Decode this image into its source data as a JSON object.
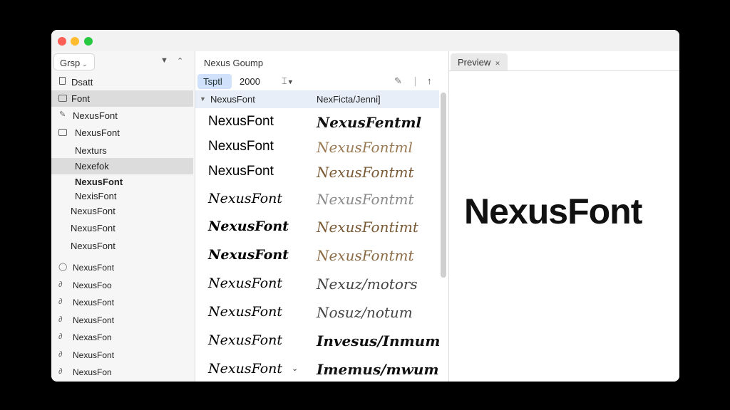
{
  "window": {
    "traffic_lights": [
      "close",
      "minimize",
      "zoom"
    ]
  },
  "sidebar": {
    "group_label": "Grsp",
    "items": [
      {
        "label": "Dsatt",
        "icon": "document-icon",
        "selected": false
      },
      {
        "label": "Font",
        "icon": "folder-icon",
        "selected": true
      },
      {
        "label": "NexusFont",
        "icon": "pencil-icon",
        "selected": false
      },
      {
        "label": "NexusFont",
        "icon": "folder-icon",
        "selected": false
      },
      {
        "label": "Nexturs",
        "icon": "",
        "selected": false
      },
      {
        "label": "Nexefok",
        "icon": "",
        "selected": true
      },
      {
        "label": "NexusFont",
        "icon": "",
        "selected": false,
        "bold": true
      },
      {
        "label": "NexisFont",
        "icon": "",
        "selected": false
      },
      {
        "label": "NexusFont",
        "icon": "",
        "selected": false
      },
      {
        "label": "NexusFont",
        "icon": "",
        "selected": false
      },
      {
        "label": "NexusFont",
        "icon": "",
        "selected": false
      },
      {
        "label": "NexusFont",
        "icon": "circle-icon",
        "selected": false
      },
      {
        "label": "NexusFoo",
        "icon": "link-icon",
        "selected": false
      },
      {
        "label": "NexusFont",
        "icon": "link-icon",
        "selected": false
      },
      {
        "label": "NexusFont",
        "icon": "link-icon",
        "selected": false
      },
      {
        "label": "NexasFon",
        "icon": "link-icon",
        "selected": false
      },
      {
        "label": "NexusFont",
        "icon": "link-icon",
        "selected": false
      },
      {
        "label": "NexusFon",
        "icon": "link-icon",
        "selected": false
      }
    ]
  },
  "middle": {
    "title": "Nexus Goump",
    "toolbar": {
      "search_value": "Tsptl",
      "size_value": "2000"
    },
    "list_header": {
      "col1": "NexusFont",
      "col2": "NexFicta/Jenni]"
    },
    "rows": [
      {
        "name": "NexusFont",
        "sample": "NexusFentml"
      },
      {
        "name": "NexusFont",
        "sample": "NexusFontml"
      },
      {
        "name": "NexusFont",
        "sample": "NexusFontmt"
      },
      {
        "name": "NexusFont",
        "sample": "NexusFontmt"
      },
      {
        "name": "NexusFont",
        "sample": "NexusFontimt"
      },
      {
        "name": "NexusFont",
        "sample": "NexusFontmt"
      },
      {
        "name": "NexusFont",
        "sample": "Nexuz/motors"
      },
      {
        "name": "NexusFont",
        "sample": "Nosuz/notum"
      },
      {
        "name": "NexusFont",
        "sample": "Invesus/Inmum"
      },
      {
        "name": "NexusFont",
        "sample": "Imemus/mwum"
      }
    ]
  },
  "preview": {
    "tab_label": "Preview",
    "sample_text": "NexusFont"
  },
  "colors": {
    "accent": "#cfe1fb",
    "selection": "#dcdcdc",
    "sample_brown": "#8a6a45",
    "sample_gray": "#8a8a8a"
  }
}
